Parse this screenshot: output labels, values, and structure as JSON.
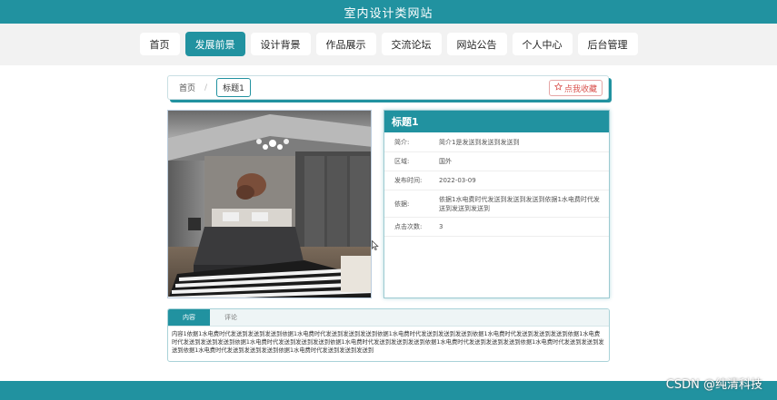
{
  "site": {
    "title": "室内设计类网站"
  },
  "nav": {
    "items": [
      {
        "label": "首页",
        "active": false
      },
      {
        "label": "发展前景",
        "active": true
      },
      {
        "label": "设计背景",
        "active": false
      },
      {
        "label": "作品展示",
        "active": false
      },
      {
        "label": "交流论坛",
        "active": false
      },
      {
        "label": "网站公告",
        "active": false
      },
      {
        "label": "个人中心",
        "active": false
      },
      {
        "label": "后台管理",
        "active": false
      }
    ]
  },
  "breadcrumb": {
    "home": "首页",
    "separator": "/",
    "current": "标题1"
  },
  "favorite": {
    "label": "点我收藏",
    "icon": "star-outline-icon"
  },
  "detail": {
    "title": "标题1",
    "rows": [
      {
        "key": "简介:",
        "value": "简介1是发送到发送到发送到"
      },
      {
        "key": "区域:",
        "value": "国外"
      },
      {
        "key": "发布时间:",
        "value": "2022-03-09"
      },
      {
        "key": "依据:",
        "value": "依据1水电费时代发送到发送到发送到依据1水电费时代发送到发送到发送到"
      },
      {
        "key": "点击次数:",
        "value": "3"
      }
    ]
  },
  "tabs": [
    {
      "label": "内容",
      "active": true
    },
    {
      "label": "评论",
      "active": false
    }
  ],
  "content": {
    "text": "内容1依据1水电费时代发送到发送到发送到依据1水电费时代发送到发送到发送到依据1水电费时代发送到发送到发送到依据1水电费时代发送到发送到发送到依据1水电费时代发送到发送到发送到依据1水电费时代发送到发送到发送到依据1水电费时代发送到发送到发送到依据1水电费时代发送到发送到发送到依据1水电费时代发送到发送到发送到依据1水电费时代发送到发送到发送到依据1水电费时代发送到发送到发送到"
  },
  "watermark": "CSDN @纯清科技",
  "colors": {
    "primary": "#2192a0",
    "favorite": "#d9534f"
  }
}
